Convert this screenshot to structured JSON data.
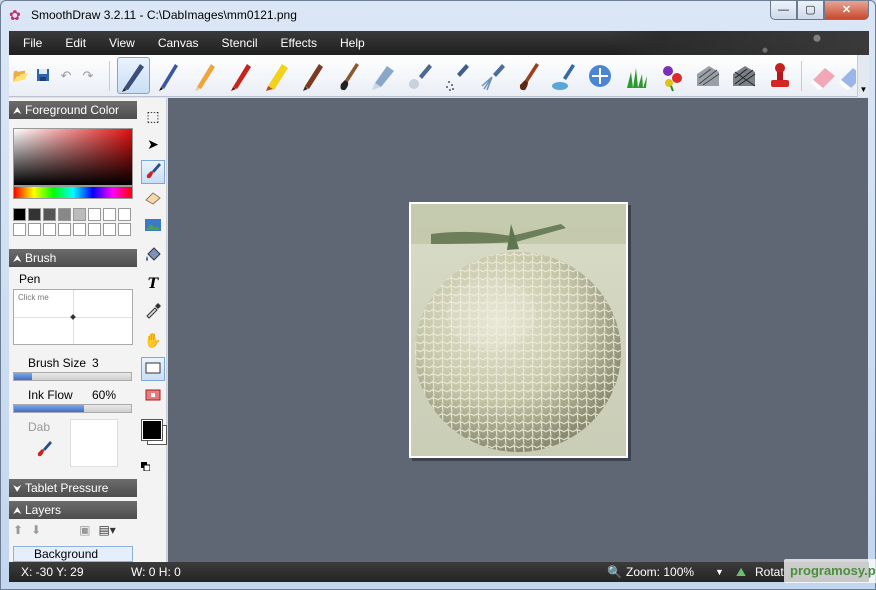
{
  "window": {
    "title": "SmoothDraw 3.2.11 - C:\\DabImages\\mm0121.png",
    "min_glyph": "—",
    "max_glyph": "▢",
    "close_glyph": "✕"
  },
  "menu": [
    "File",
    "Edit",
    "View",
    "Canvas",
    "Stencil",
    "Effects",
    "Help"
  ],
  "toolbar": {
    "file_icons": [
      "open-folder",
      "save",
      "undo",
      "redo"
    ],
    "brushes": [
      "pen",
      "fine-pen",
      "pencil",
      "red-pencil",
      "marker",
      "fountain-pen",
      "brush",
      "eraser-shape",
      "airbrush",
      "spray",
      "jet-spray",
      "oil-brush",
      "watercolor",
      "blur-ring",
      "grass",
      "flowers",
      "hatch",
      "hatch-2",
      "stamp",
      "eraser-pink",
      "eraser-blue"
    ]
  },
  "foreground": {
    "header": "Foreground Color",
    "grays": [
      "#000000",
      "#333333",
      "#555555",
      "#888888",
      "#bbbbbb",
      "#ffffff",
      "#ffffff",
      "#ffffff"
    ]
  },
  "brush": {
    "header": "Brush",
    "name": "Pen",
    "preview_hint": "Click me",
    "size_label": "Brush Size",
    "size_value": "3",
    "size_fraction": 0.15,
    "flow_label": "Ink Flow",
    "flow_value": "60%",
    "flow_fraction": 0.6,
    "dab_label": "Dab"
  },
  "tablet": {
    "header": "Tablet Pressure"
  },
  "layers": {
    "header": "Layers",
    "items": [
      "Background"
    ]
  },
  "tools": [
    "selection-rect",
    "move",
    "brush",
    "eraser",
    "image",
    "fill",
    "text",
    "eyedropper",
    "hand",
    "rect-select",
    "color-swap"
  ],
  "status": {
    "coords": "X: -30 Y: 29",
    "size": "W: 0 H: 0",
    "zoom": "Zoom: 100%",
    "rotate": "Rotat",
    "watermark": "programosy.pl"
  },
  "colors": {
    "menubar": "#2a2a2a",
    "canvas": "#5f6674",
    "panel_header": "#595959",
    "accent": "#3f6fc8"
  }
}
